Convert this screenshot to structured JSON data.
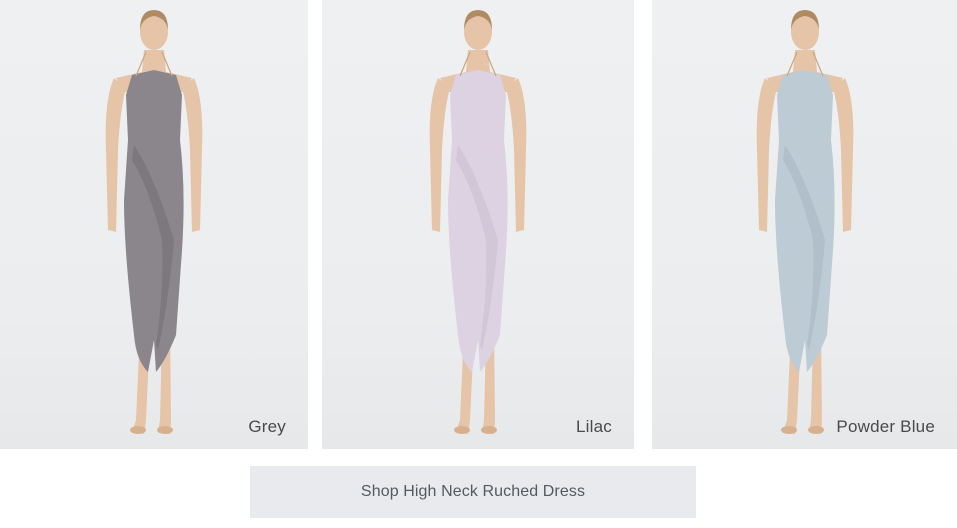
{
  "products": [
    {
      "color_name": "Grey",
      "dress_color": "#8a868b",
      "dress_shade": "#716d73"
    },
    {
      "color_name": "Lilac",
      "dress_color": "#ddd2e2",
      "dress_shade": "#c9bccf"
    },
    {
      "color_name": "Powder Blue",
      "dress_color": "#bccbd4",
      "dress_shade": "#a6b7c1"
    }
  ],
  "shop_button": {
    "label": "Shop High Neck Ruched Dress"
  },
  "skin_color": "#e6c4a8",
  "hair_color": "#b08a62"
}
